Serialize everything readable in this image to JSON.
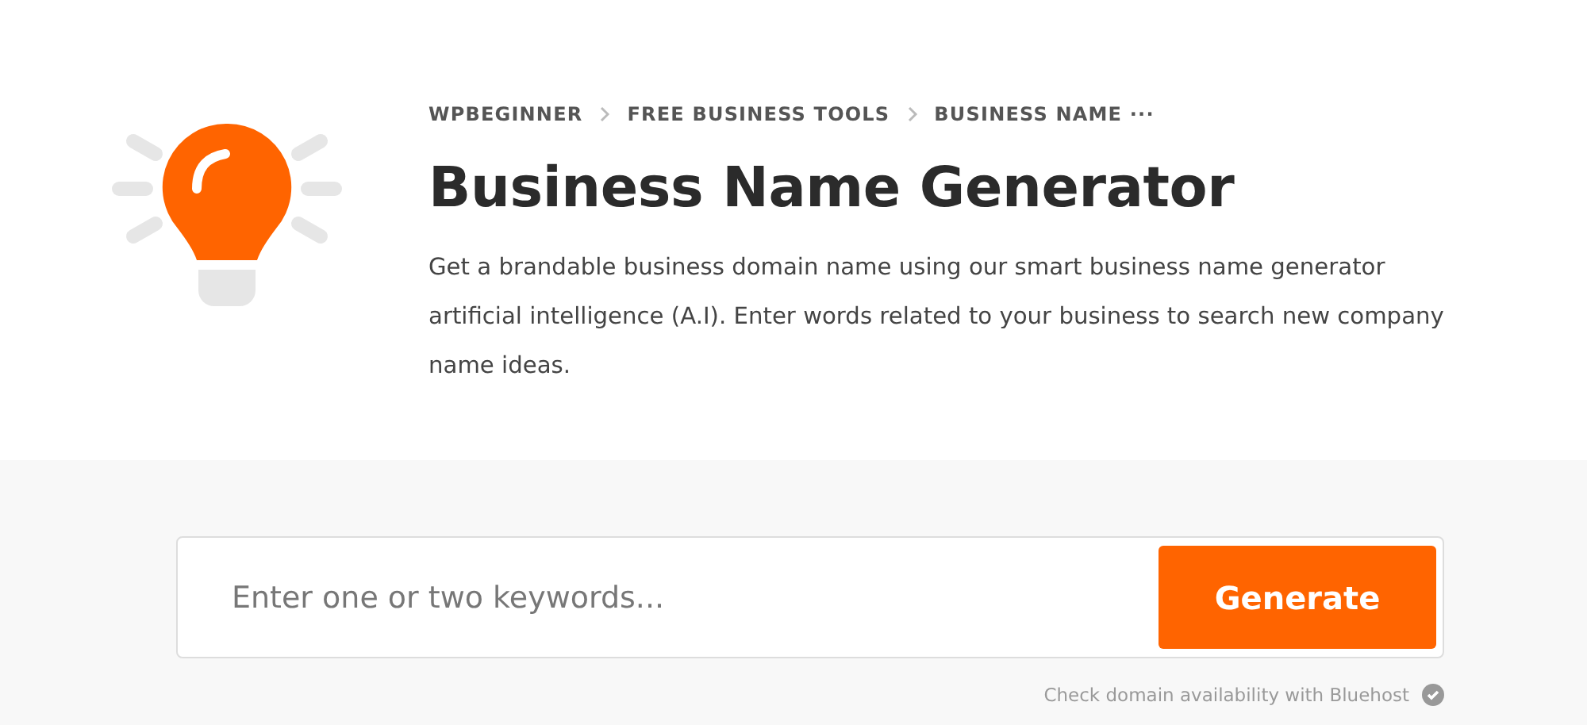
{
  "breadcrumb": [
    "WPBEGINNER",
    "FREE BUSINESS TOOLS",
    "BUSINESS NAME ···"
  ],
  "title": "Business Name Generator",
  "description": "Get a brandable business domain name using our smart business name generator artificial intelligence (A.I). Enter words related to your business to search new company name ideas.",
  "search": {
    "placeholder": "Enter one or two keywords...",
    "button": "Generate"
  },
  "note": "Check domain availability with Bluehost"
}
